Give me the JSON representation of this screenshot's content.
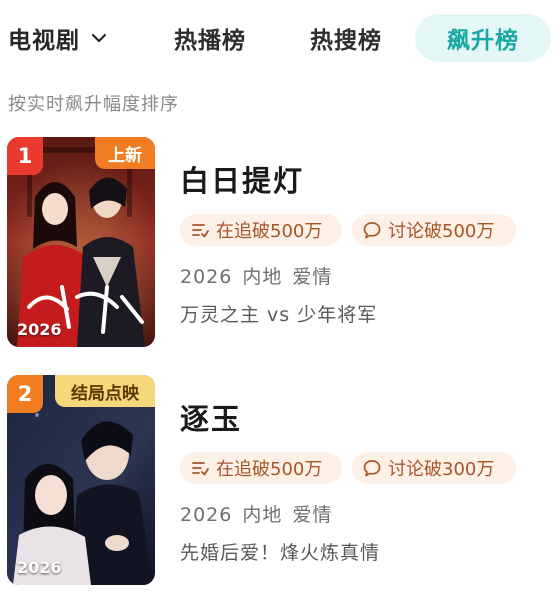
{
  "header": {
    "category": "电视剧",
    "tabs": [
      {
        "label": "热播榜",
        "active": false
      },
      {
        "label": "热搜榜",
        "active": false
      },
      {
        "label": "飙升榜",
        "active": true
      }
    ]
  },
  "sort_description": "按实时飙升幅度排序",
  "colors": {
    "accent": "#1aa8a4",
    "active_tab_bg": "#e4f7f6",
    "chip_bg": "#fdf1e7",
    "chip_text": "#a8552a",
    "rank_1": "#e83b2e",
    "rank_2": "#f07d22"
  },
  "items": [
    {
      "rank": "1",
      "corner_tag": "上新",
      "poster_year": "2026",
      "title": "白日提灯",
      "chips": [
        {
          "icon": "follow-list-icon",
          "text": "在追破500万"
        },
        {
          "icon": "comment-bubble-icon",
          "text": "讨论破500万"
        }
      ],
      "year": "2026",
      "region": "内地",
      "genre": "爱情",
      "description": "万灵之主 vs 少年将军"
    },
    {
      "rank": "2",
      "corner_tag": "结局点映",
      "poster_year": "2026",
      "title": "逐玉",
      "chips": [
        {
          "icon": "follow-list-icon",
          "text": "在追破500万"
        },
        {
          "icon": "comment-bubble-icon",
          "text": "讨论破300万"
        }
      ],
      "year": "2026",
      "region": "内地",
      "genre": "爱情",
      "description": "先婚后爱！烽火炼真情"
    }
  ]
}
